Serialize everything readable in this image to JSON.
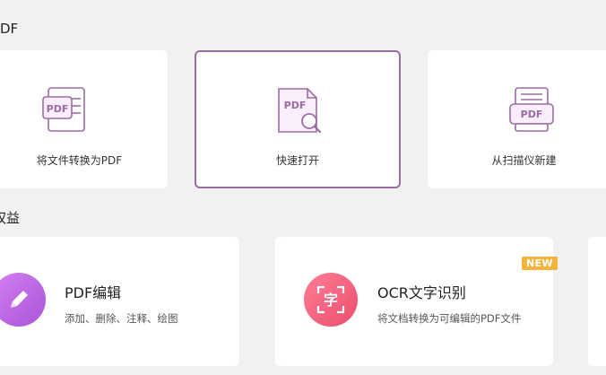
{
  "sections": {
    "pdf_title": "DF",
    "rights_title": "权益"
  },
  "quick_actions": [
    {
      "label": "将文件转换为PDF",
      "icon": "pdf-convert-icon"
    },
    {
      "label": "快速打开",
      "icon": "pdf-search-icon"
    },
    {
      "label": "从扫描仪新建",
      "icon": "scanner-icon"
    }
  ],
  "features": [
    {
      "title": "PDF编辑",
      "desc": "添加、删除、注释、绘图",
      "icon": "pencil-icon"
    },
    {
      "title": "OCR文字识别",
      "desc": "将文档转换为可编辑的PDF文件",
      "icon": "ocr-char-icon",
      "icon_text": "字",
      "badge": "NEW"
    }
  ],
  "icon_text": {
    "pdf": "PDF"
  },
  "colors": {
    "accent": "#9b6ba4",
    "pink": "#f25f7c",
    "purple": "#b25ee0",
    "badge": "#f6b33c"
  }
}
